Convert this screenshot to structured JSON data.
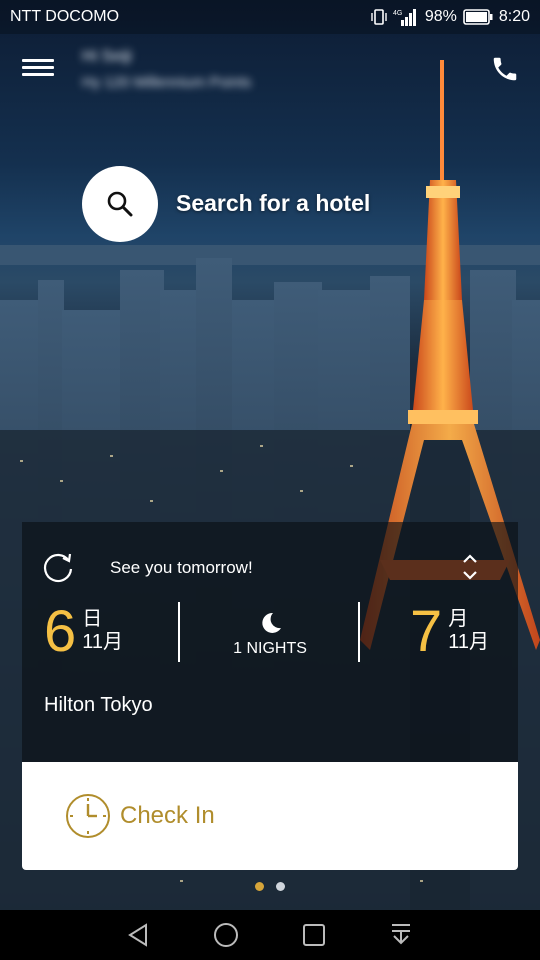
{
  "status_bar": {
    "carrier": "NTT DOCOMO",
    "network": "4G",
    "battery": "98%",
    "time": "8:20"
  },
  "header": {
    "user_name": "Hi Seiji",
    "user_sub": "Hy 120 Millennium Points",
    "icons": {
      "menu": "hamburger-menu-icon",
      "phone": "phone-icon"
    }
  },
  "search": {
    "label": "Search for a hotel",
    "icon": "search-icon"
  },
  "stay": {
    "greeting": "See you tomorrow!",
    "check_in": {
      "day": "6",
      "weekday": "日",
      "month": "11月"
    },
    "nights": "1 NIGHTS",
    "check_out": {
      "day": "7",
      "weekday": "月",
      "month": "11月"
    },
    "hotel": "Hilton Tokyo"
  },
  "checkin": {
    "label": "Check In",
    "icon": "clock-icon"
  },
  "pager": {
    "count": 2,
    "active_index": 0
  },
  "colors": {
    "accent_gold": "#f5c044",
    "checkin_text": "#b08d2c",
    "card_overlay": "rgba(10,14,20,0.62)"
  }
}
